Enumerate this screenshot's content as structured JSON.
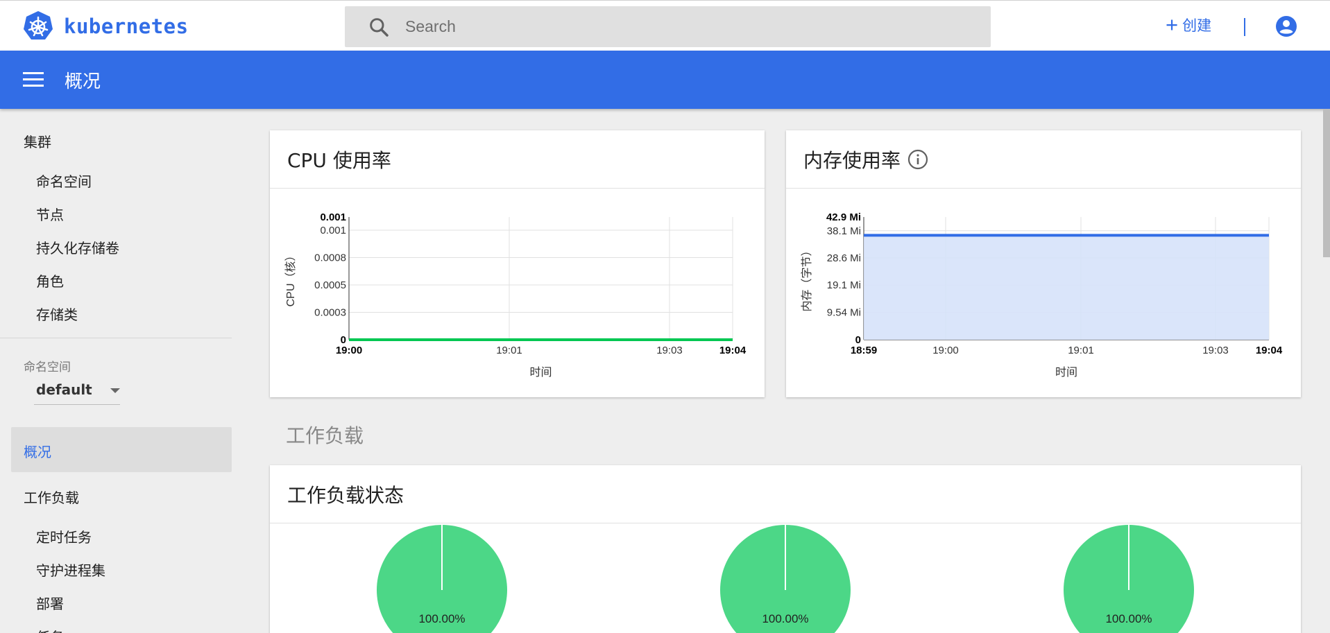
{
  "app": {
    "logo_text": "kubernetes"
  },
  "search": {
    "placeholder": "Search"
  },
  "actions": {
    "create_label": "创建"
  },
  "header": {
    "title": "概况"
  },
  "sidebar": {
    "cluster_heading": "集群",
    "cluster_items": [
      "命名空间",
      "节点",
      "持久化存储卷",
      "角色",
      "存储类"
    ],
    "namespace_label": "命名空间",
    "namespace_value": "default",
    "active_item": "概况",
    "workloads_heading": "工作负载",
    "workload_items": [
      "定时任务",
      "守护进程集",
      "部署",
      "任务"
    ]
  },
  "cpu_card": {
    "title": "CPU 使用率"
  },
  "memory_card": {
    "title": "内存使用率"
  },
  "workloads_section": {
    "title": "工作负载"
  },
  "workload_status_card": {
    "title": "工作负载状态"
  },
  "colors": {
    "accent": "#326de6",
    "cpu_line": "#00c752",
    "memory_line": "#326de6",
    "memory_fill": "#d6e2fa",
    "pie_green": "#4cd787"
  },
  "chart_data": [
    {
      "type": "line",
      "title": "CPU 使用率",
      "xlabel": "时间",
      "ylabel": "CPU（核）",
      "x_ticks": [
        "19:00",
        "19:01",
        "19:03",
        "19:04"
      ],
      "y_ticks": [
        "0",
        "0.0003",
        "0.0005",
        "0.0008",
        "0.001",
        "0.001"
      ],
      "y_tick_values": [
        0,
        0.00025,
        0.0005,
        0.00075,
        0.001,
        0.00112
      ],
      "ylim": [
        0,
        0.00112
      ],
      "series": [
        {
          "values": [
            0,
            0,
            0,
            0
          ]
        }
      ],
      "grid": true
    },
    {
      "type": "area",
      "title": "内存使用率",
      "xlabel": "时间",
      "ylabel": "内存（字节）",
      "x_ticks": [
        "18:59",
        "19:00",
        "19:01",
        "19:03",
        "19:04"
      ],
      "y_ticks": [
        "0",
        "9.54 Mi",
        "19.1 Mi",
        "28.6 Mi",
        "38.1 Mi",
        "42.9 Mi"
      ],
      "y_tick_values": [
        0,
        9.54,
        19.1,
        28.6,
        38.1,
        42.9
      ],
      "ylim": [
        0,
        42.9
      ],
      "series": [
        {
          "values": [
            36.5,
            36.5,
            36.5,
            36.5,
            36.5
          ]
        }
      ],
      "grid": true
    },
    {
      "type": "pie",
      "charts": [
        {
          "slices": [
            100
          ],
          "label": "100.00%"
        },
        {
          "slices": [
            100
          ],
          "label": "100.00%"
        },
        {
          "slices": [
            100
          ],
          "label": "100.00%"
        }
      ]
    }
  ]
}
